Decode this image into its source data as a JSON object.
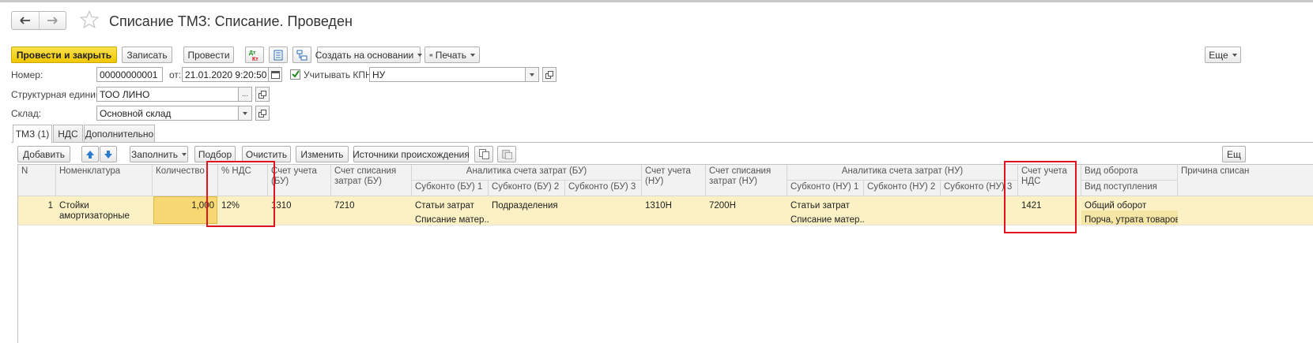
{
  "window": {
    "title": "Списание ТМЗ: Списание. Проведен"
  },
  "toolbar": {
    "post_close": "Провести и закрыть",
    "save": "Записать",
    "post": "Провести",
    "dtkt_icon": "dt-kt-icon",
    "create_based": "Создать на основании",
    "print": "Печать",
    "more": "Еще"
  },
  "form": {
    "number_label": "Номер:",
    "number_value": "00000000001",
    "date_label": "от:",
    "date_value": "21.01.2020  9:20:50",
    "kpn_label": "Учитывать КПН",
    "kpn_checked": true,
    "kpn_value": "НУ",
    "unit_label": "Структурная единица:",
    "unit_value": "ТОО ЛИНО",
    "warehouse_label": "Склад:",
    "warehouse_value": "Основной склад"
  },
  "tabs": [
    {
      "label": "ТМЗ (1)",
      "active": true
    },
    {
      "label": "НДС",
      "active": false
    },
    {
      "label": "Дополнительно",
      "active": false
    }
  ],
  "table_toolbar": {
    "add": "Добавить",
    "fill": "Заполнить",
    "selection": "Подбор",
    "clear": "Очистить",
    "change": "Изменить",
    "sources": "Источники происхождения",
    "more": "Ещ"
  },
  "table": {
    "headers": {
      "n": "N",
      "nomenclature": "Номенклатура",
      "quantity": "Количество",
      "vat_percent": "% НДС",
      "account_bu": "Счет учета (БУ)",
      "writeoff_account_bu": "Счет списания затрат (БУ)",
      "analytics_bu": "Аналитика счета затрат (БУ)",
      "subconto_bu_1": "Субконто (БУ) 1",
      "subconto_bu_2": "Субконто (БУ) 2",
      "subconto_bu_3": "Субконто (БУ) 3",
      "account_nu": "Счет учета (НУ)",
      "writeoff_account_nu": "Счет списания затрат (НУ)",
      "analytics_nu": "Аналитика счета затрат (НУ)",
      "subconto_nu_1": "Субконто (НУ) 1",
      "subconto_nu_2": "Субконто (НУ) 2",
      "subconto_nu_3": "Субконто (НУ) 3",
      "vat_account": "Счет учета НДС",
      "turnover_type": "Вид оборота",
      "receipt_type": "Вид поступления",
      "writeoff_reason": "Причина списан"
    },
    "rows": [
      {
        "n": "1",
        "nomenclature_line1": "Стойки",
        "nomenclature_line2": "амортизаторные",
        "quantity": "1,000",
        "vat_percent": "12%",
        "account_bu": "1310",
        "writeoff_account_bu": "7210",
        "subconto_bu_1_a": "Статьи затрат",
        "subconto_bu_1_b": "Списание матер...",
        "subconto_bu_2": "Подразделения",
        "account_nu": "1310Н",
        "writeoff_account_nu": "7200Н",
        "subconto_nu_1_a": "Статьи затрат",
        "subconto_nu_1_b": "Списание матер...",
        "vat_account": "1421",
        "turnover_type": "Общий оборот",
        "receipt_type": "Порча, утрата товаров"
      }
    ]
  },
  "colors": {
    "primary_button": "#f5cf10",
    "selected_row": "#fbf1c4",
    "active_cell": "#f7d872",
    "highlight_box": "#e0141e"
  }
}
